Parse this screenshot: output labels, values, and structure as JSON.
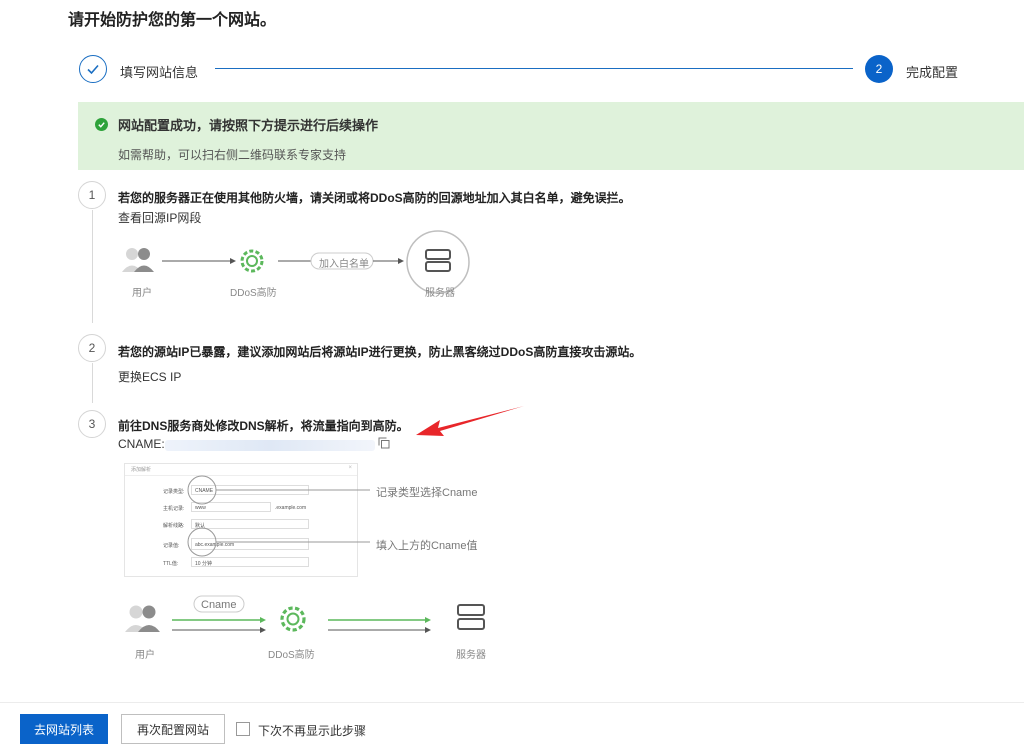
{
  "page": {
    "title": "请开始防护您的第一个网站。"
  },
  "steps": [
    {
      "label": "填写网站信息",
      "state": "done"
    },
    {
      "number": "2",
      "label": "完成配置",
      "state": "active"
    }
  ],
  "banner": {
    "title": "网站配置成功，请按照下方提示进行后续操作",
    "subtitle": "如需帮助，可以扫右侧二维码联系专家支持"
  },
  "items": [
    {
      "number": "1",
      "title": "若您的服务器正在使用其他防火墙，请关闭或将DDoS高防的回源地址加入其白名单，避免误拦。",
      "link": "查看回源IP网段",
      "diagram": {
        "user": "用户",
        "ddos": "DDoS高防",
        "whitelist": "加入白名单",
        "server": "服务器"
      }
    },
    {
      "number": "2",
      "title": "若您的源站IP已暴露，建议添加网站后将源站IP进行更换，防止黑客绕过DDoS高防直接攻击源站。",
      "link": "更换ECS IP"
    },
    {
      "number": "3",
      "title": "前往DNS服务商处修改DNS解析，将流量指向到高防。",
      "cname_label": "CNAME:",
      "mini_form": {
        "header": "添加解析",
        "rows": [
          {
            "label": "记录类型:",
            "value": "CNAME"
          },
          {
            "label": "主机记录:",
            "value": "www",
            "suffix": ".example.com"
          },
          {
            "label": "解析线路:",
            "value": "默认"
          },
          {
            "label": "记录值:",
            "value": "abc.example.com"
          },
          {
            "label": "TTL值:",
            "value": "10 分钟"
          }
        ]
      },
      "annotations": {
        "type": "记录类型选择Cname",
        "value": "填入上方的Cname值"
      },
      "diagram": {
        "cname_tag": "Cname",
        "user": "用户",
        "ddos": "DDoS高防",
        "server": "服务器"
      }
    }
  ],
  "footer": {
    "primary_button": "去网站列表",
    "secondary_button": "再次配置网站",
    "checkbox_label": "下次不再显示此步骤",
    "checkbox_checked": false
  },
  "colors": {
    "primary": "#0a63c9",
    "success_bg": "#dff2db",
    "success_icon": "#2ea23a",
    "ddos_green": "#5cb85c",
    "annotation_arrow": "#e8262a"
  }
}
